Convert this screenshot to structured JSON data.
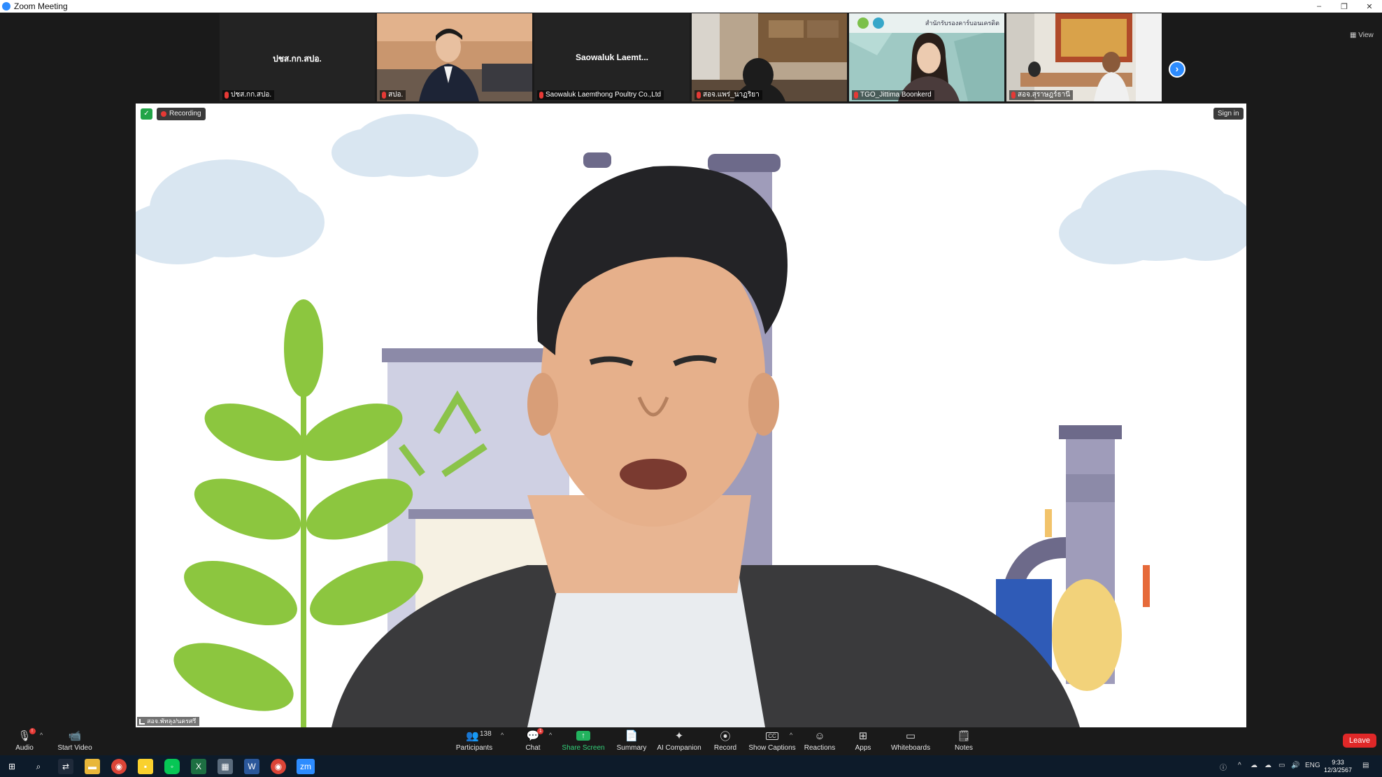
{
  "window": {
    "title": "Zoom Meeting",
    "minimize_glyph": "–",
    "restore_glyph": "❐",
    "close_glyph": "✕"
  },
  "participants_strip": {
    "tiles": [
      {
        "center_name": "ปชส.กก.สปอ.",
        "name": "ปชส.กก.สปอ."
      },
      {
        "center_name": "",
        "name": "สปอ."
      },
      {
        "center_name": "Saowaluk  Laemt...",
        "name": "Saowaluk Laemthong Poultry Co.,Ltd"
      },
      {
        "center_name": "",
        "name": "สอจ.แพร่_นาฏริยา"
      },
      {
        "center_name": "",
        "name": "TGO_Jittima Boonkerd"
      },
      {
        "center_name": "",
        "name": "สอจ.สุราษฎร์ธานี"
      }
    ],
    "next_glyph": "›",
    "view_label": "View"
  },
  "main": {
    "recording_label": "Recording",
    "sign_in_label": "Sign in",
    "speaker_name": "สอจ.พัทลุง/นครศรี",
    "banner_text": "สำนักรับรองคาร์บอนเครดิต"
  },
  "controls": {
    "audio": {
      "label": "Audio",
      "badge": "!"
    },
    "start_video": {
      "label": "Start Video"
    },
    "participants": {
      "label": "Participants",
      "count": "138"
    },
    "chat": {
      "label": "Chat",
      "badge": "1"
    },
    "share_screen": {
      "label": "Share Screen"
    },
    "summary": {
      "label": "Summary"
    },
    "ai_companion": {
      "label": "AI Companion"
    },
    "record": {
      "label": "Record"
    },
    "show_captions": {
      "label": "Show Captions",
      "icon_text": "CC"
    },
    "reactions": {
      "label": "Reactions"
    },
    "apps": {
      "label": "Apps"
    },
    "whiteboards": {
      "label": "Whiteboards"
    },
    "notes": {
      "label": "Notes"
    },
    "leave": {
      "label": "Leave"
    }
  },
  "taskbar": {
    "zoom_label": "zm",
    "language": "ENG",
    "time": "9:33",
    "date": "12/3/2567"
  },
  "colors": {
    "accent_blue": "#2d8cff",
    "recording_red": "#e53935",
    "share_green": "#22b35e",
    "leave_red": "#e02828"
  }
}
